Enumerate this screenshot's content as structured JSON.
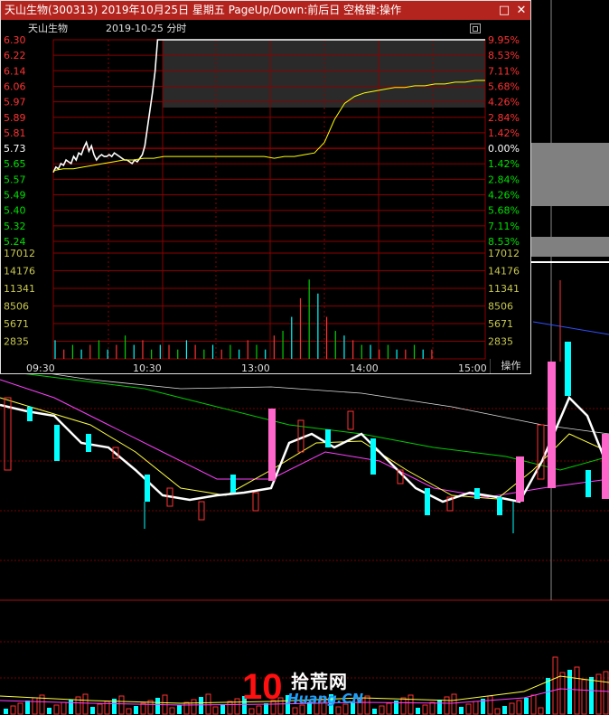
{
  "window": {
    "title": "天山生物(300313) 2019年10月25日 星期五 PageUp/Down:前后日 空格键:操作",
    "min_glyph": "□",
    "close_glyph": "✕"
  },
  "header": {
    "stock_name": "天山生物",
    "date_label": "2019-10-25 分时"
  },
  "price_labels": [
    "6.30",
    "6.22",
    "6.14",
    "6.06",
    "5.97",
    "5.89",
    "5.81",
    "5.73",
    "5.65",
    "5.57",
    "5.49",
    "5.40",
    "5.32",
    "5.24"
  ],
  "pct_labels": [
    "9.95%",
    "8.53%",
    "7.11%",
    "5.68%",
    "4.26%",
    "2.84%",
    "1.42%",
    "0.00%",
    "1.42%",
    "2.84%",
    "4.26%",
    "5.68%",
    "7.11%",
    "8.53%"
  ],
  "volume_labels": [
    "17012",
    "14176",
    "11341",
    "8506",
    "5671",
    "2835"
  ],
  "time_labels": [
    "09:30",
    "10:30",
    "13:00",
    "14:00",
    "15:00"
  ],
  "operate_label": "操作",
  "colors": {
    "up": "#ff3232",
    "down": "#00ffff",
    "neutral": "#ffffff",
    "grid": "#8b0000",
    "volume_axis": "#c8c850",
    "price_line": "#ffffff",
    "avg_line": "#ffff00"
  },
  "chart_data": {
    "type": "line",
    "title": "",
    "prev_close": 5.73,
    "ylim": [
      5.16,
      6.3
    ],
    "limit_up": 6.3,
    "series": [
      {
        "role": "price",
        "values": [
          5.55,
          5.58,
          5.57,
          5.6,
          5.59,
          5.62,
          5.61,
          5.6,
          5.64,
          5.62,
          5.66,
          5.65,
          5.69,
          5.72,
          5.67,
          5.7,
          5.65,
          5.62,
          5.64,
          5.65,
          5.64,
          5.64,
          5.65,
          5.64,
          5.66,
          5.65,
          5.64,
          5.63,
          5.62,
          5.62,
          5.61,
          5.6,
          5.62,
          5.61,
          5.63,
          5.65,
          5.7,
          5.8,
          5.9,
          6.0,
          6.12,
          6.3,
          6.3,
          6.3
        ]
      },
      {
        "role": "average",
        "values": [
          5.56,
          5.57,
          5.57,
          5.58,
          5.59,
          5.6,
          5.61,
          5.62,
          5.62,
          5.63,
          5.63,
          5.64,
          5.64,
          5.64,
          5.64,
          5.64,
          5.64,
          5.64,
          5.64,
          5.64,
          5.64,
          5.64,
          5.63,
          5.64,
          5.64,
          5.65,
          5.66,
          5.72,
          5.85,
          5.94,
          5.98,
          6.0,
          6.01,
          6.02,
          6.03,
          6.03,
          6.04,
          6.04,
          6.05,
          6.05,
          6.06,
          6.06,
          6.07,
          6.07
        ]
      }
    ],
    "volume": [
      4,
      2,
      3,
      2,
      3,
      4,
      2,
      3,
      5,
      3,
      4,
      2,
      3,
      3,
      2,
      4,
      3,
      2,
      3,
      2,
      3,
      2,
      4,
      3,
      2,
      5,
      6,
      9,
      13,
      17,
      14,
      9,
      6,
      5,
      4,
      3,
      3,
      2,
      3,
      2,
      2,
      3,
      2,
      2
    ],
    "volume_max": 17012
  }
}
